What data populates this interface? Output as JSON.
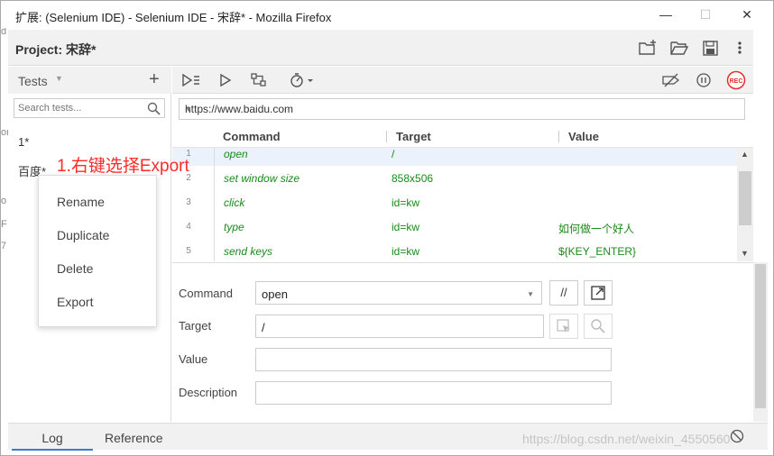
{
  "window": {
    "title": "扩展: (Selenium IDE) - Selenium IDE - 宋辞* - Mozilla Firefox",
    "minimize": "—",
    "maximize": "☐",
    "close": "✕"
  },
  "project": {
    "label": "Project:",
    "name": "宋辞*"
  },
  "sidebar": {
    "header": "Tests",
    "add": "+",
    "search_placeholder": "Search tests...",
    "items": [
      {
        "label": "1*"
      },
      {
        "label": "百度*"
      }
    ]
  },
  "annotation": "1.右键选择Export",
  "context_menu": {
    "items": [
      "Rename",
      "Duplicate",
      "Delete",
      "Export"
    ]
  },
  "url": "https://www.baidu.com",
  "grid": {
    "headers": [
      "Command",
      "Target",
      "Value"
    ],
    "rows": [
      {
        "num": "1",
        "command": "open",
        "target": "/",
        "value": ""
      },
      {
        "num": "2",
        "command": "set window size",
        "target": "858x506",
        "value": ""
      },
      {
        "num": "3",
        "command": "click",
        "target": "id=kw",
        "value": ""
      },
      {
        "num": "4",
        "command": "type",
        "target": "id=kw",
        "value": "如何做一个好人"
      },
      {
        "num": "5",
        "command": "send keys",
        "target": "id=kw",
        "value": "${KEY_ENTER}"
      }
    ]
  },
  "editor": {
    "command_label": "Command",
    "command_value": "open",
    "comment_btn": "//",
    "target_label": "Target",
    "target_value": "/",
    "value_label": "Value",
    "value_value": "",
    "description_label": "Description",
    "description_value": ""
  },
  "bottom_tabs": {
    "log": "Log",
    "reference": "Reference"
  },
  "toolbar": {
    "rec": "REC"
  },
  "left_edge": [
    "d",
    "or",
    "o",
    "F",
    "7"
  ],
  "watermark": "https://blog.csdn.net/weixin_4550560",
  "colors": {
    "command_green": "#1a8a1a",
    "annotation_red": "#ff2a2a",
    "rec_red": "#e0302c",
    "active_tab": "#3a7bd5"
  }
}
